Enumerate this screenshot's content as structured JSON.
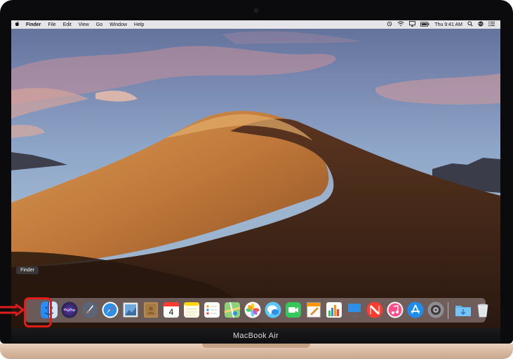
{
  "menubar": {
    "apple_icon": "apple-logo-icon",
    "app_name": "Finder",
    "items": [
      "File",
      "Edit",
      "View",
      "Go",
      "Window",
      "Help"
    ],
    "status_icons": [
      "time-machine-icon",
      "wifi-icon",
      "airplay-icon",
      "battery-icon"
    ],
    "clock": "Thu 9:41 AM",
    "right_icons": [
      "spotlight-search-icon",
      "siri-icon",
      "notification-center-icon"
    ]
  },
  "dock": {
    "tooltip": "Finder",
    "apps": [
      {
        "name": "Finder",
        "icon": "finder-icon"
      },
      {
        "name": "Siri",
        "icon": "siri-icon"
      },
      {
        "name": "Launchpad",
        "icon": "launchpad-icon"
      },
      {
        "name": "Safari",
        "icon": "safari-icon"
      },
      {
        "name": "Mail",
        "icon": "mail-icon"
      },
      {
        "name": "Contacts",
        "icon": "contacts-icon"
      },
      {
        "name": "Calendar",
        "icon": "calendar-icon",
        "badge_text": "4"
      },
      {
        "name": "Notes",
        "icon": "notes-icon"
      },
      {
        "name": "Reminders",
        "icon": "reminders-icon"
      },
      {
        "name": "Maps",
        "icon": "maps-icon"
      },
      {
        "name": "Photos",
        "icon": "photos-icon"
      },
      {
        "name": "Messages",
        "icon": "messages-icon"
      },
      {
        "name": "FaceTime",
        "icon": "facetime-icon"
      },
      {
        "name": "Pages",
        "icon": "pages-icon"
      },
      {
        "name": "Numbers",
        "icon": "numbers-icon"
      },
      {
        "name": "Keynote",
        "icon": "keynote-icon"
      },
      {
        "name": "News",
        "icon": "news-icon"
      },
      {
        "name": "Music",
        "icon": "music-icon"
      },
      {
        "name": "App Store",
        "icon": "app-store-icon"
      },
      {
        "name": "System Preferences",
        "icon": "system-preferences-icon"
      }
    ],
    "right": [
      {
        "name": "Downloads",
        "icon": "downloads-folder-icon"
      },
      {
        "name": "Trash",
        "icon": "trash-icon"
      }
    ]
  },
  "device": {
    "label": "MacBook Air"
  },
  "annotation": {
    "highlight_color": "#e21b1b"
  }
}
